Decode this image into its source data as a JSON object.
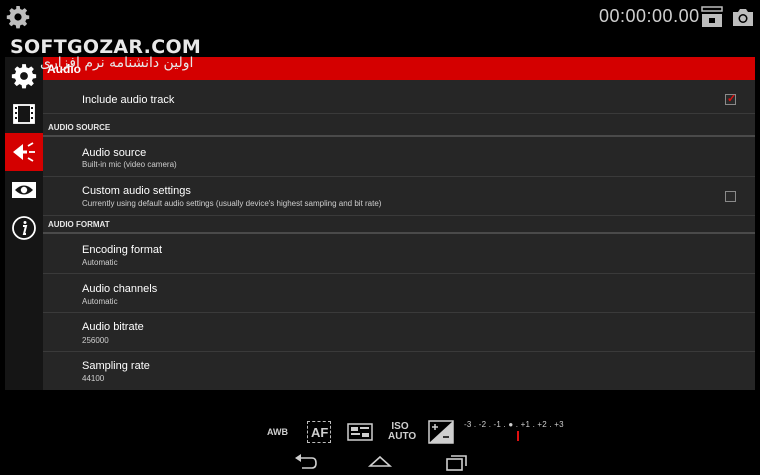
{
  "topbar": {
    "settings_icon": "gear-icon",
    "timer": "00:00:00.00",
    "mode_icon": "video-photo-toggle-icon",
    "camera_icon": "camera-icon"
  },
  "watermark": {
    "text": "SOFTGOZAR.COM",
    "tagline": "اولین دانشنامه نرم افزاری"
  },
  "sidenav": {
    "items": [
      {
        "name": "settings",
        "icon": "gear-icon"
      },
      {
        "name": "video",
        "icon": "film-icon"
      },
      {
        "name": "audio",
        "icon": "audio-icon",
        "active": true
      },
      {
        "name": "display",
        "icon": "eye-icon"
      },
      {
        "name": "info",
        "icon": "info-icon"
      }
    ]
  },
  "panel": {
    "header": "Audio",
    "include_audio": {
      "title": "Include audio track",
      "checked": true
    },
    "section_source": "AUDIO SOURCE",
    "audio_source": {
      "title": "Audio source",
      "value": "Built-in mic (video camera)"
    },
    "custom_audio": {
      "title": "Custom audio settings",
      "value": "Currently using default audio settings (usually device's highest sampling and bit rate)",
      "checked": false
    },
    "section_format": "AUDIO FORMAT",
    "encoding": {
      "title": "Encoding format",
      "value": "Automatic"
    },
    "channels": {
      "title": "Audio channels",
      "value": "Automatic"
    },
    "bitrate": {
      "title": "Audio bitrate",
      "value": "256000"
    },
    "sampling": {
      "title": "Sampling rate",
      "value": "44100"
    }
  },
  "controls": {
    "awb": "AWB",
    "af": "AF",
    "iso_top": "ISO",
    "iso_bottom": "AUTO",
    "ev_scale": "-3 . -2 . -1 . ● . +1 . +2 . +3",
    "ev_value": 0
  },
  "colors": {
    "accent": "#d40000",
    "panel_bg": "#262626",
    "background": "#000000"
  }
}
